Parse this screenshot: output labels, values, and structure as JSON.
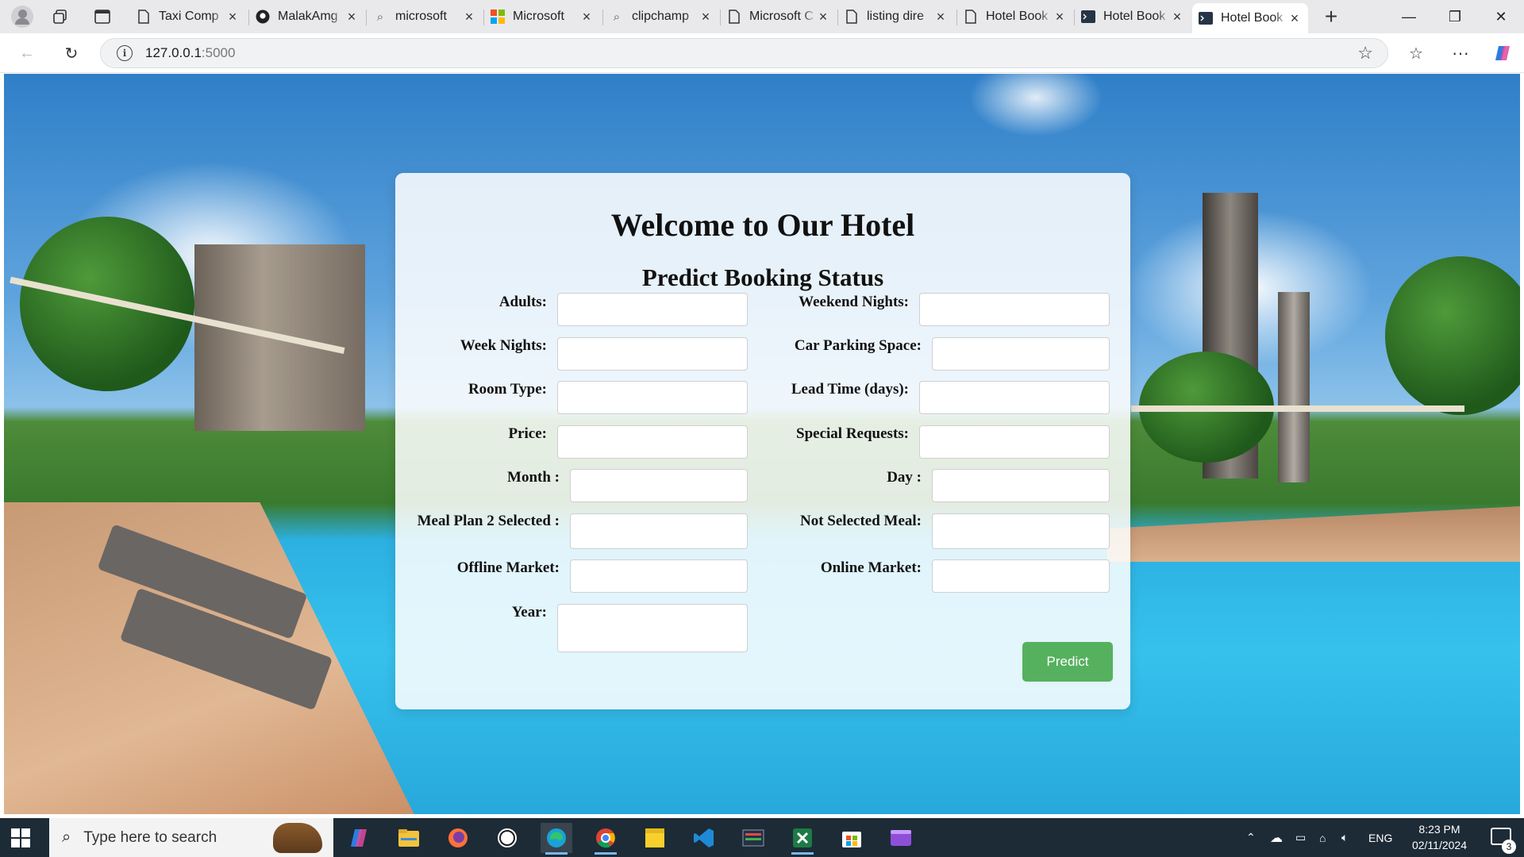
{
  "browser": {
    "tabs": [
      {
        "title": "Taxi Comp",
        "icon": "page-icon",
        "active": false
      },
      {
        "title": "MalakAmg",
        "icon": "github-icon",
        "active": false
      },
      {
        "title": "microsoft",
        "icon": "search-icon",
        "active": false
      },
      {
        "title": "Microsoft",
        "icon": "microsoft-logo-icon",
        "active": false
      },
      {
        "title": "clipchamp",
        "icon": "search-icon",
        "active": false
      },
      {
        "title": "Microsoft C",
        "icon": "page-icon",
        "active": false
      },
      {
        "title": "listing dire",
        "icon": "page-icon",
        "active": false
      },
      {
        "title": "Hotel Book",
        "icon": "page-icon",
        "active": false
      },
      {
        "title": "Hotel Book",
        "icon": "terminal-icon",
        "active": false
      },
      {
        "title": "Hotel Book",
        "icon": "terminal-icon",
        "active": true
      }
    ],
    "url_host": "127.0.0.1",
    "url_port": ":5000"
  },
  "page": {
    "title": "Welcome to Our Hotel",
    "subtitle": "Predict Booking Status",
    "fields_left": [
      {
        "label": "Adults:",
        "value": ""
      },
      {
        "label": "Week Nights:",
        "value": ""
      },
      {
        "label": "Room Type:",
        "value": ""
      },
      {
        "label": "Price:",
        "value": ""
      },
      {
        "label": "Month :",
        "value": ""
      },
      {
        "label": "Meal Plan 2 Selected :",
        "value": ""
      },
      {
        "label": "Offline Market:",
        "value": ""
      },
      {
        "label": "Year:",
        "value": ""
      }
    ],
    "fields_right": [
      {
        "label": "Weekend Nights:",
        "value": ""
      },
      {
        "label": "Car Parking Space:",
        "value": ""
      },
      {
        "label": "Lead Time (days):",
        "value": ""
      },
      {
        "label": "Special Requests:",
        "value": ""
      },
      {
        "label": "Day :",
        "value": ""
      },
      {
        "label": "Not Selected Meal:",
        "value": ""
      },
      {
        "label": "Online Market:",
        "value": ""
      }
    ],
    "predict_label": "Predict",
    "predict_color": "#56b15f"
  },
  "taskbar": {
    "search_placeholder": "Type here to search",
    "language": "ENG",
    "time": "8:23 PM",
    "date": "02/11/2024",
    "notification_count": "3",
    "apps": [
      "copilot-icon",
      "file-explorer-icon",
      "firefox-icon",
      "whatsapp-icon",
      "edge-icon",
      "chrome-icon",
      "sticky-notes-icon",
      "vscode-icon",
      "app-icon",
      "excel-icon",
      "microsoft-store-icon",
      "clipchamp-icon"
    ]
  }
}
